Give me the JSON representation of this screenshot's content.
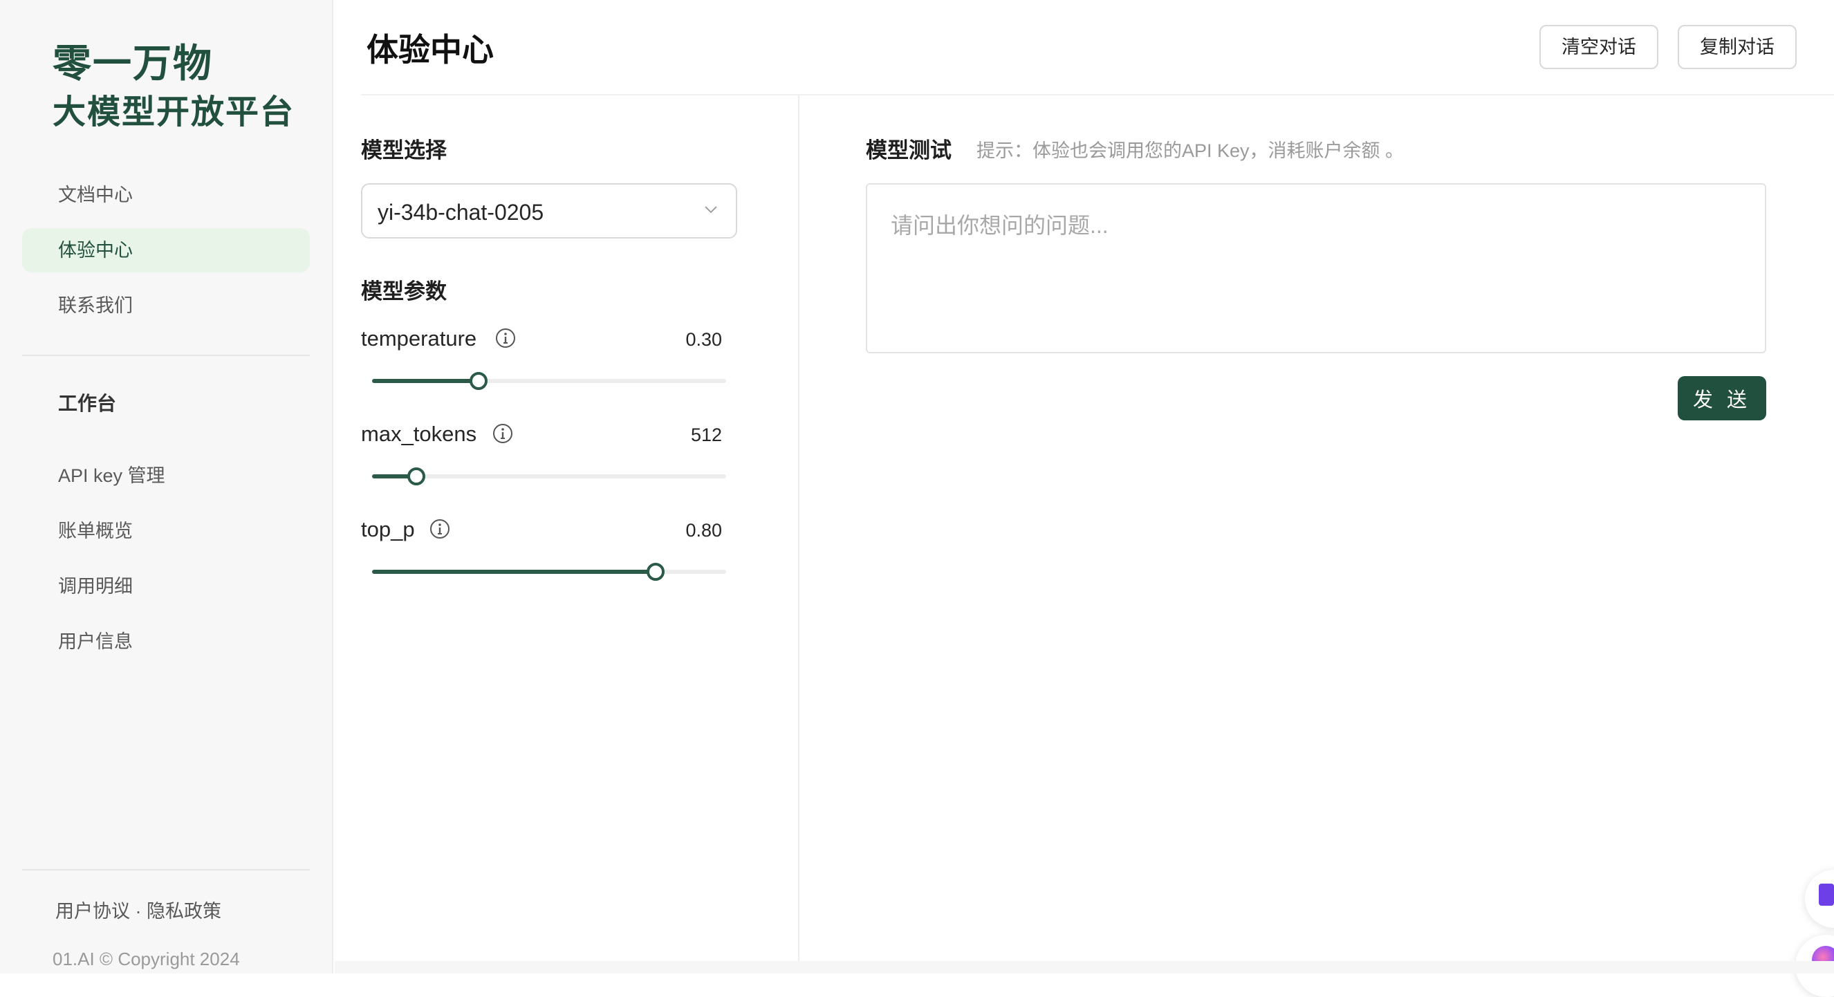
{
  "sidebar": {
    "brand_line1": "零一万物",
    "brand_line2": "大模型开放平台",
    "nav": [
      {
        "label": "文档中心"
      },
      {
        "label": "体验中心",
        "active": true
      },
      {
        "label": "联系我们"
      }
    ],
    "workspace_title": "工作台",
    "workspace_items": [
      {
        "label": "API key 管理"
      },
      {
        "label": "账单概览"
      },
      {
        "label": "调用明细"
      },
      {
        "label": "用户信息"
      }
    ],
    "footer": {
      "terms": "用户协议",
      "separator": " · ",
      "privacy": "隐私政策",
      "copyright": "01.AI © Copyright 2024"
    }
  },
  "header": {
    "title": "体验中心",
    "clear_button": "清空对话",
    "copy_button": "复制对话"
  },
  "config": {
    "model_select_label": "模型选择",
    "model_selected": "yi-34b-chat-0205",
    "params_label": "模型参数",
    "params": [
      {
        "name": "temperature",
        "value_text": "0.30",
        "fraction": 0.3
      },
      {
        "name": "max_tokens",
        "value_text": "512",
        "fraction": 0.125
      },
      {
        "name": "top_p",
        "value_text": "0.80",
        "fraction": 0.8
      }
    ]
  },
  "test": {
    "label": "模型测试",
    "hint": "提示：体验也会调用您的API Key，消耗账户余额 。",
    "prompt_placeholder": "请问出你想问的问题...",
    "send_button": "发 送"
  },
  "colors": {
    "accent": "#22503f",
    "active_nav_bg": "#e8f4e8"
  }
}
